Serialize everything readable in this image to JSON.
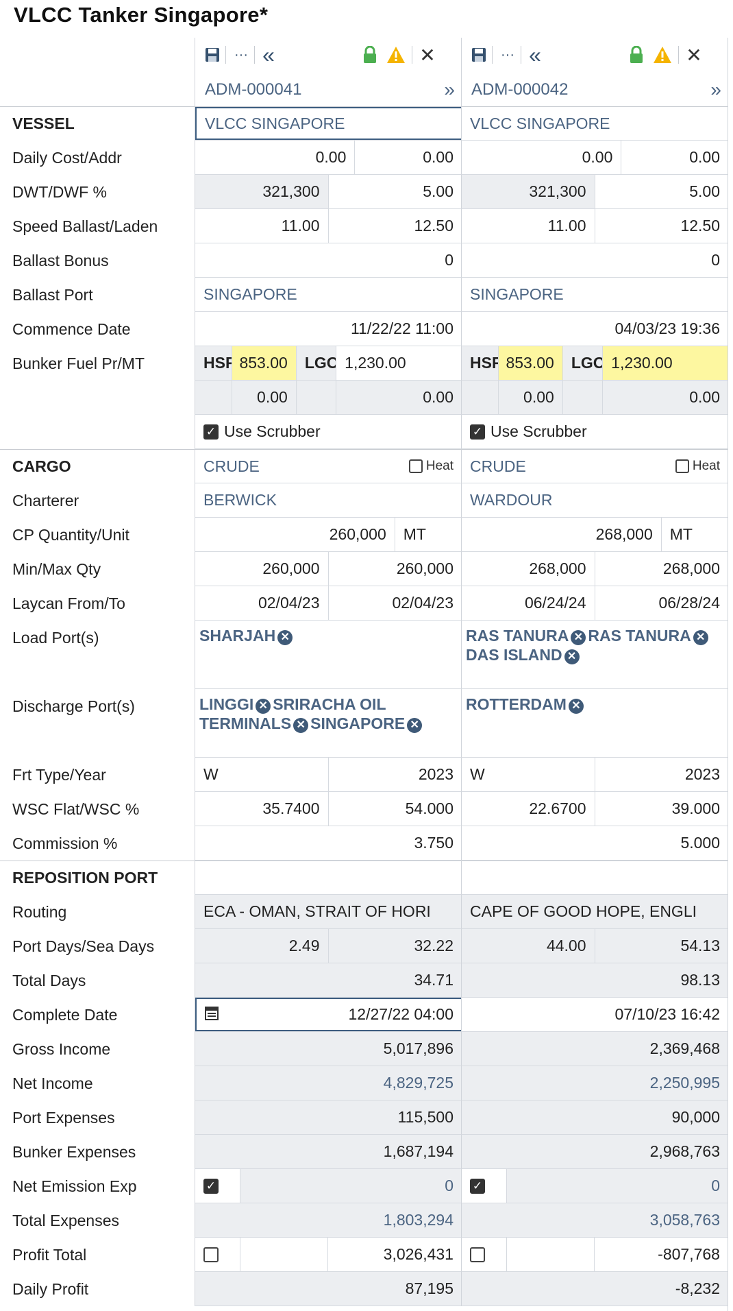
{
  "title": "VLCC Tanker Singapore*",
  "labels": {
    "vessel": "VESSEL",
    "daily_cost": "Daily Cost/Addr",
    "dwt": "DWT/DWF %",
    "speed": "Speed Ballast/Laden",
    "ballast_bonus": "Ballast Bonus",
    "ballast_port": "Ballast Port",
    "commence": "Commence Date",
    "bunker": "Bunker Fuel Pr/MT",
    "cargo": "CARGO",
    "charterer": "Charterer",
    "cp_qty": "CP Quantity/Unit",
    "minmax": "Min/Max Qty",
    "laycan": "Laycan From/To",
    "load": "Load Port(s)",
    "discharge": "Discharge Port(s)",
    "frt": "Frt Type/Year",
    "wsc": "WSC Flat/WSC %",
    "commission": "Commission %",
    "repo": "REPOSITION PORT",
    "routing": "Routing",
    "portdays": "Port Days/Sea Days",
    "totaldays": "Total Days",
    "complete": "Complete Date",
    "gross": "Gross Income",
    "net": "Net Income",
    "portexp": "Port Expenses",
    "bunkexp": "Bunker Expenses",
    "netem": "Net Emission Exp",
    "totexp": "Total Expenses",
    "profit": "Profit Total",
    "daily": "Daily Profit"
  },
  "common": {
    "use_scrubber": "Use Scrubber",
    "heat": "Heat",
    "hsf": "HSF",
    "lgo": "LGO",
    "unit": "MT",
    "nav_prev": "«",
    "nav_next": "»",
    "more": "···",
    "close": "✕"
  },
  "columns": [
    {
      "id": "ADM-000041",
      "vessel": "VLCC SINGAPORE",
      "daily_cost": "0.00",
      "addr": "0.00",
      "dwt": "321,300",
      "dwf": "5.00",
      "speed_ballast": "11.00",
      "speed_laden": "12.50",
      "ballast_bonus": "0",
      "ballast_port": "SINGAPORE",
      "commence": "11/22/22 11:00",
      "hsf_price": "853.00",
      "lgo_price": "1,230.00",
      "hsf_2": "0.00",
      "lgo_2": "0.00",
      "cargo": "CRUDE",
      "charterer": "BERWICK",
      "cp_qty": "260,000",
      "min_qty": "260,000",
      "max_qty": "260,000",
      "laycan_from": "02/04/23",
      "laycan_to": "02/04/23",
      "load_ports": [
        "SHARJAH"
      ],
      "discharge_ports": [
        "LINGGI",
        "SRIRACHA OIL TERMINALS",
        "SINGAPORE"
      ],
      "frt_type": "W",
      "frt_year": "2023",
      "wsc_flat": "35.7400",
      "wsc_pct": "54.000",
      "commission": "3.750",
      "routing": "ECA - OMAN, STRAIT OF HORI",
      "port_days": "2.49",
      "sea_days": "32.22",
      "total_days": "34.71",
      "complete": "12/27/22 04:00",
      "gross": "5,017,896",
      "net": "4,829,725",
      "portexp": "115,500",
      "bunkexp": "1,687,194",
      "netem": "0",
      "totexp": "1,803,294",
      "profit": "3,026,431",
      "daily": "87,195"
    },
    {
      "id": "ADM-000042",
      "vessel": "VLCC SINGAPORE",
      "daily_cost": "0.00",
      "addr": "0.00",
      "dwt": "321,300",
      "dwf": "5.00",
      "speed_ballast": "11.00",
      "speed_laden": "12.50",
      "ballast_bonus": "0",
      "ballast_port": "SINGAPORE",
      "commence": "04/03/23 19:36",
      "hsf_price": "853.00",
      "lgo_price": "1,230.00",
      "hsf_2": "0.00",
      "lgo_2": "0.00",
      "cargo": "CRUDE",
      "charterer": "WARDOUR",
      "cp_qty": "268,000",
      "min_qty": "268,000",
      "max_qty": "268,000",
      "laycan_from": "06/24/24",
      "laycan_to": "06/28/24",
      "load_ports": [
        "RAS TANURA",
        "RAS TANURA",
        "DAS ISLAND"
      ],
      "discharge_ports": [
        "ROTTERDAM"
      ],
      "frt_type": "W",
      "frt_year": "2023",
      "wsc_flat": "22.6700",
      "wsc_pct": "39.000",
      "commission": "5.000",
      "routing": "CAPE OF GOOD HOPE, ENGLI",
      "port_days": "44.00",
      "sea_days": "54.13",
      "total_days": "98.13",
      "complete": "07/10/23 16:42",
      "gross": "2,369,468",
      "net": "2,250,995",
      "portexp": "90,000",
      "bunkexp": "2,968,763",
      "netem": "0",
      "totexp": "3,058,763",
      "profit": "-807,768",
      "daily": "-8,232"
    }
  ]
}
